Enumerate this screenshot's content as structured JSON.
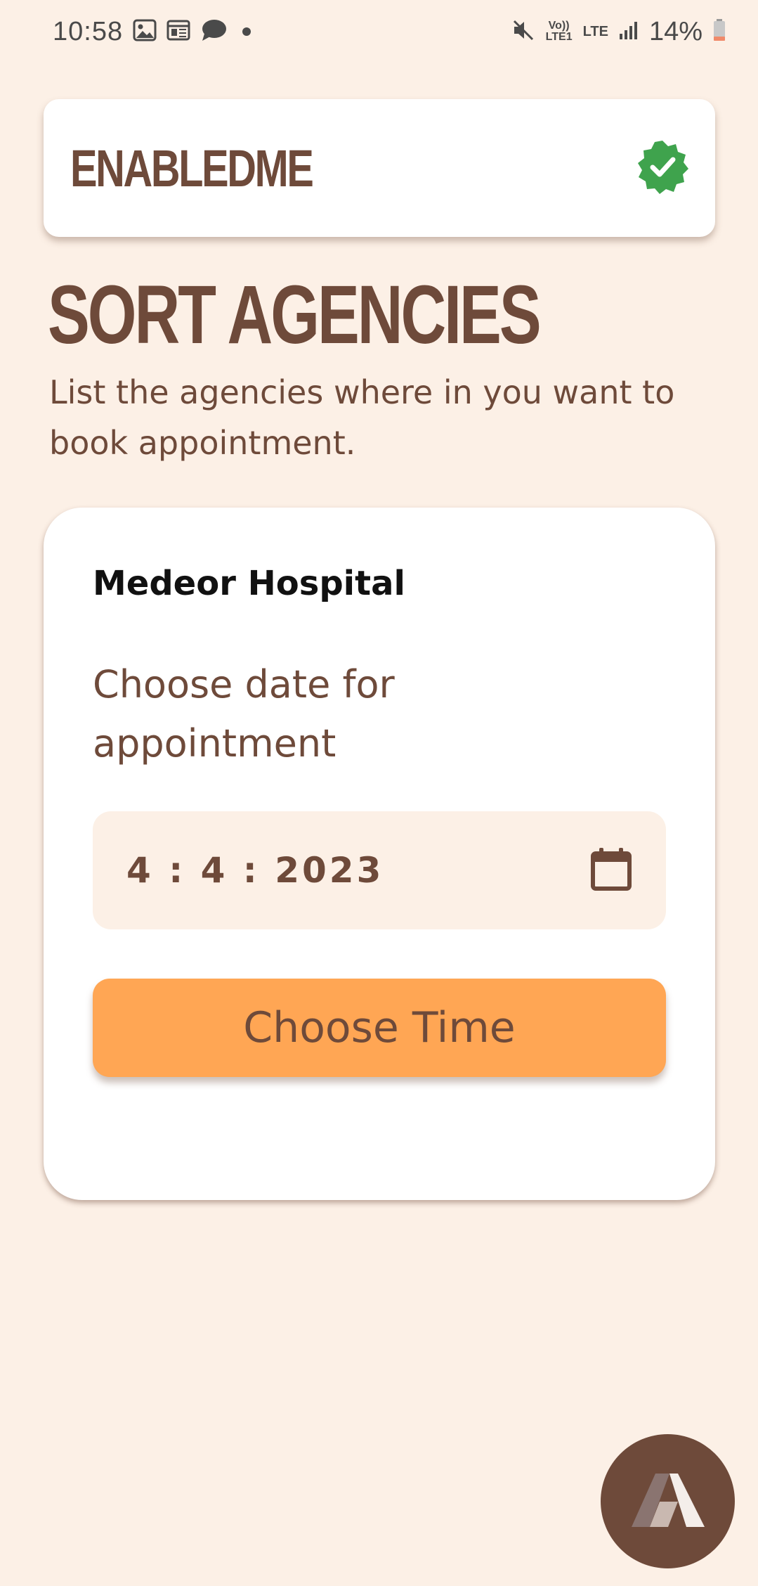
{
  "status_bar": {
    "time": "10:58",
    "battery": "14%",
    "volte_label": "Vo)) LTE1",
    "lte_label": "LTE",
    "left_icons": [
      "image-icon",
      "calendar-news-icon",
      "chat-bubble-icon",
      "dot-icon"
    ],
    "right_icons": [
      "mute-icon",
      "volte-icon",
      "lte-icon",
      "signal-icon",
      "battery-icon"
    ]
  },
  "header": {
    "brand": "ENABLEDME",
    "verified_icon": "verified-badge-icon",
    "verified_color": "#3fa34d"
  },
  "page": {
    "title": "SORT AGENCIES",
    "subtitle": "List the agencies where in you want to book appointment."
  },
  "agency_card": {
    "name": "Medeor Hospital",
    "date_label": "Choose date for appointment",
    "date_value": "4 : 4 : 2023",
    "calendar_icon": "calendar-icon",
    "choose_time_label": "Choose Time"
  },
  "fab": {
    "icon": "app-logo-icon"
  },
  "colors": {
    "background": "#fcf0e6",
    "primary_brown": "#6e4a3a",
    "accent_orange": "#ffa654",
    "card": "#ffffff"
  }
}
